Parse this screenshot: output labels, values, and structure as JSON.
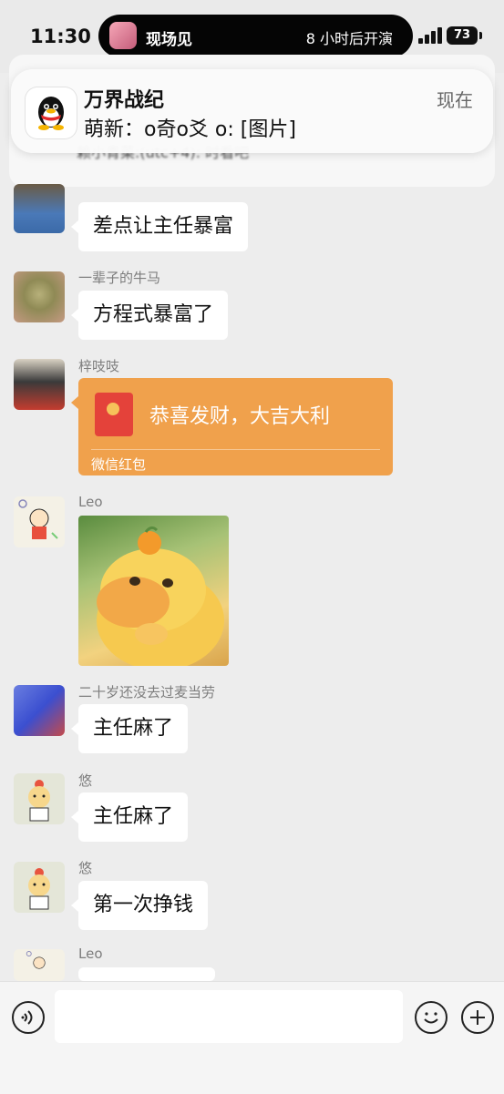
{
  "status_bar": {
    "time": "11:30",
    "live_activity_left": "现场见",
    "live_activity_right": "8 小时后开演",
    "battery": "73"
  },
  "notification": {
    "app": "qq",
    "title": "万界战纪",
    "body": "萌新：o奇o爻 o: [图片]",
    "time": "现在"
  },
  "pinned_preview": "赖小青菜:(utc+4): 时看吧",
  "messages": [
    {
      "sender": "",
      "text": "差点让主任暴富"
    },
    {
      "sender": "一辈子的牛马",
      "text": "方程式暴富了"
    },
    {
      "sender": "梓吱吱",
      "type": "red_packet",
      "title": "恭喜发财，大吉大利",
      "label": "微信红包"
    },
    {
      "sender": "Leo",
      "type": "image"
    },
    {
      "sender": "二十岁还没去过麦当劳",
      "text": "主任麻了"
    },
    {
      "sender": "悠",
      "text": "主任麻了"
    },
    {
      "sender": "悠",
      "text": "第一次挣钱"
    },
    {
      "sender": "Leo",
      "text": ""
    }
  ],
  "colors": {
    "background": "#ededed",
    "bubble": "#ffffff",
    "red_packet": "#f0a14c",
    "sender_text": "#7d7d7d"
  }
}
